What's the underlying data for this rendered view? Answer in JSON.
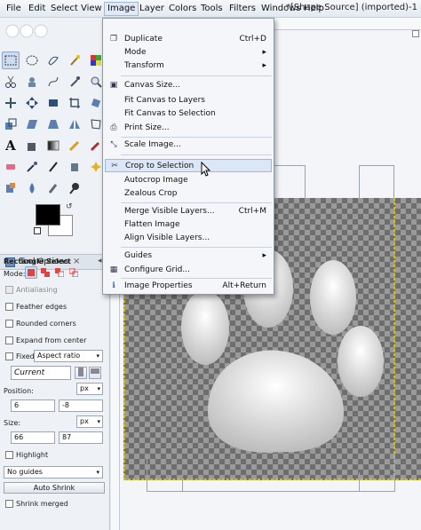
{
  "menubar": {
    "items": [
      "File",
      "Edit",
      "Select",
      "View",
      "Image",
      "Layer",
      "Colors",
      "Tools",
      "Filters",
      "Windows",
      "Help"
    ],
    "active": "Image",
    "title": "*[Shape Source] (imported)-1"
  },
  "image_menu": {
    "items": [
      {
        "label": "Duplicate",
        "shortcut": "Ctrl+D",
        "icon": "duplicate-icon"
      },
      {
        "label": "Mode",
        "submenu": true
      },
      {
        "label": "Transform",
        "submenu": true
      },
      {
        "label": "Canvas Size...",
        "icon": "canvas-size-icon"
      },
      {
        "label": "Fit Canvas to Layers"
      },
      {
        "label": "Fit Canvas to Selection"
      },
      {
        "label": "Print Size...",
        "icon": "print-size-icon"
      },
      {
        "label": "Scale Image...",
        "icon": "scale-icon"
      },
      {
        "label": "Crop to Selection",
        "icon": "crop-icon",
        "highlighted": true
      },
      {
        "label": "Autocrop Image"
      },
      {
        "label": "Zealous Crop"
      },
      {
        "label": "Merge Visible Layers...",
        "shortcut": "Ctrl+M"
      },
      {
        "label": "Flatten Image"
      },
      {
        "label": "Align Visible Layers..."
      },
      {
        "label": "Guides",
        "submenu": true
      },
      {
        "label": "Configure Grid...",
        "icon": "grid-icon"
      },
      {
        "label": "Image Properties",
        "shortcut": "Alt+Return",
        "icon": "info-icon"
      }
    ]
  },
  "tool_options": {
    "tab_label": "Tool Options",
    "tool_name": "Rectangle Select",
    "mode_label": "Mode:",
    "antialiasing": "Antialiasing",
    "feather_edges": "Feather edges",
    "rounded_corners": "Rounded corners",
    "expand_from_center": "Expand from center",
    "fixed_label": "Fixed:",
    "fixed_value": "Aspect ratio",
    "current_placeholder": "Current",
    "position_label": "Position:",
    "position_unit": "px",
    "position_x": "6",
    "position_y": "-8",
    "size_label": "Size:",
    "size_unit": "px",
    "size_w": "66",
    "size_h": "87",
    "highlight": "Highlight",
    "guides_value": "No guides",
    "auto_shrink": "Auto Shrink",
    "shrink_merged": "Shrink merged"
  },
  "colors": {
    "foreground": "#000000",
    "background": "#ffffff",
    "menu_highlight": "#dbe7f6"
  }
}
